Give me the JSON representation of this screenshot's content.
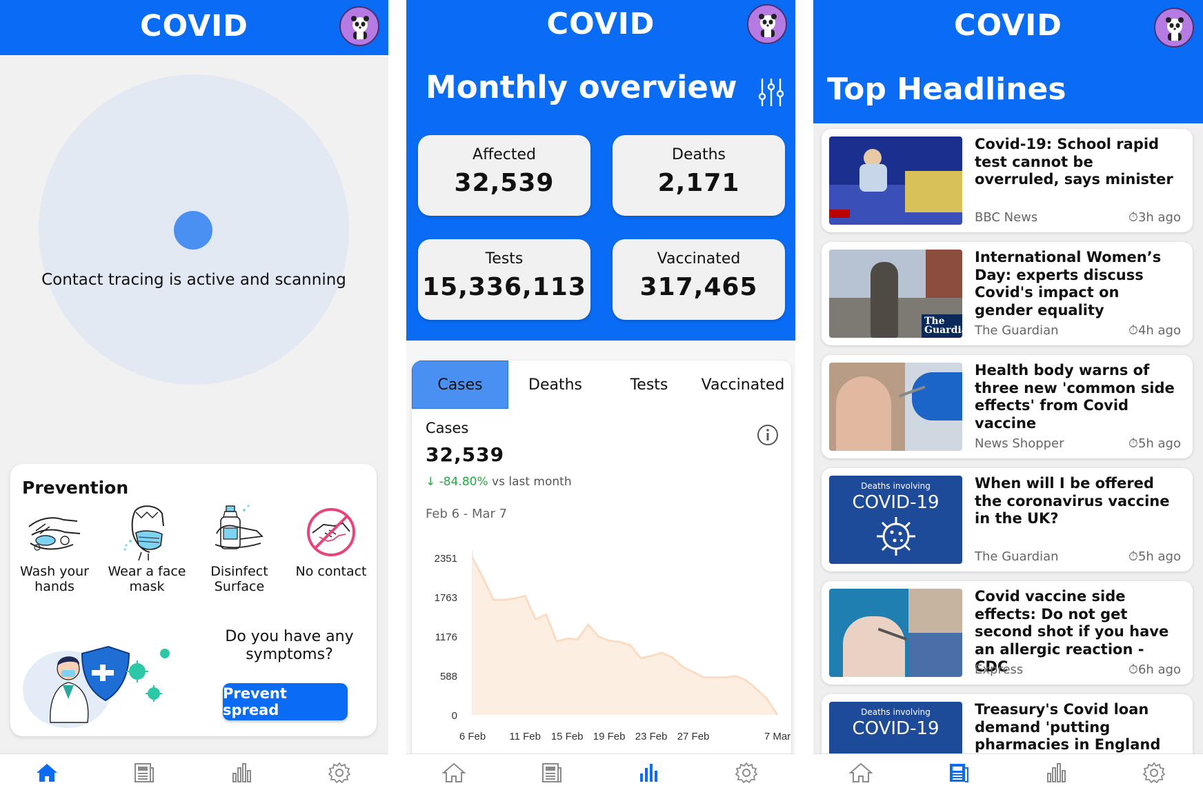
{
  "app_title": "COVID",
  "home": {
    "tracing_text": "Contact tracing is active and scanning",
    "prevention": {
      "title": "Prevention",
      "items": [
        {
          "label": "Wash your hands",
          "icon": "hand-wash-icon"
        },
        {
          "label": "Wear a face mask",
          "icon": "face-mask-icon"
        },
        {
          "label": "Disinfect Surface",
          "icon": "disinfect-icon"
        },
        {
          "label": "No contact",
          "icon": "no-handshake-icon"
        }
      ],
      "symptoms_question": "Do you have any symptoms?",
      "prevent_button": "Prevent spread"
    }
  },
  "overview": {
    "title": "Monthly overview",
    "stats": [
      {
        "label": "Affected",
        "value": "32,539"
      },
      {
        "label": "Deaths",
        "value": "2,171"
      },
      {
        "label": "Tests",
        "value": "15,336,113"
      },
      {
        "label": "Vaccinated",
        "value": "317,465"
      }
    ],
    "tabs": [
      "Cases",
      "Deaths",
      "Tests",
      "Vaccinated"
    ],
    "active_tab": "Cases",
    "chart_label": "Cases",
    "chart_value": "32,539",
    "change": "-84.80%",
    "change_suffix": "vs last month",
    "date_range": "Feb 6  - Mar 7"
  },
  "chart_data": {
    "type": "area",
    "x": [
      "6 Feb",
      "7 Feb",
      "8 Feb",
      "9 Feb",
      "10 Feb",
      "11 Feb",
      "12 Feb",
      "13 Feb",
      "14 Feb",
      "15 Feb",
      "16 Feb",
      "17 Feb",
      "18 Feb",
      "19 Feb",
      "20 Feb",
      "21 Feb",
      "22 Feb",
      "23 Feb",
      "24 Feb",
      "25 Feb",
      "26 Feb",
      "27 Feb",
      "28 Feb",
      "1 Mar",
      "2 Mar",
      "3 Mar",
      "4 Mar",
      "5 Mar",
      "6 Mar",
      "7 Mar"
    ],
    "values": [
      2351,
      2050,
      1720,
      1720,
      1740,
      1780,
      1430,
      1500,
      1100,
      1140,
      1130,
      1350,
      1170,
      1110,
      1090,
      1040,
      850,
      880,
      930,
      860,
      720,
      640,
      560,
      560,
      560,
      580,
      520,
      390,
      240,
      0
    ],
    "ylim": [
      0,
      2351
    ],
    "y_ticks": [
      0,
      588,
      1176,
      1763,
      2351
    ],
    "x_tick_labels": [
      "6 Feb",
      "11 Feb",
      "15 Feb",
      "19 Feb",
      "23 Feb",
      "27 Feb",
      "7 Mar"
    ],
    "x_tick_index": [
      0,
      5,
      9,
      13,
      17,
      21,
      29
    ],
    "color": "#fdeee2",
    "line_color": "#fbdcc3"
  },
  "headlines": {
    "title": "Top Headlines",
    "items": [
      {
        "title": "Covid-19: School rapid test cannot be overruled, says minister",
        "source": "BBC News",
        "time": "3h ago"
      },
      {
        "title": "International Women’s Day: experts discuss Covid's impact on gender equality",
        "source": "The Guardian",
        "time": "4h ago",
        "thumb_text": "The Guardia"
      },
      {
        "title": "Health body warns of three new 'common side effects' from Covid vaccine",
        "source": "News Shopper",
        "time": "5h ago"
      },
      {
        "title": "When will I be offered the coronavirus vaccine in the UK?",
        "source": "The Guardian",
        "time": "5h ago",
        "thumb_small": "Deaths involving",
        "thumb_big": "COVID-19"
      },
      {
        "title": "Covid vaccine side effects: Do not get second shot if you have an allergic reaction - CDC",
        "source": "Express",
        "time": "6h ago"
      },
      {
        "title": "Treasury's Covid loan demand 'putting pharmacies in England at",
        "source": "",
        "time": "",
        "thumb_small": "Deaths involving",
        "thumb_big": "COVID-19"
      }
    ]
  },
  "colors": {
    "primary": "#0a6cf5",
    "accent_light": "#4a90f2",
    "positive": "#29a745"
  },
  "nav_icons": [
    "home-icon",
    "news-icon",
    "stats-icon",
    "settings-icon"
  ]
}
